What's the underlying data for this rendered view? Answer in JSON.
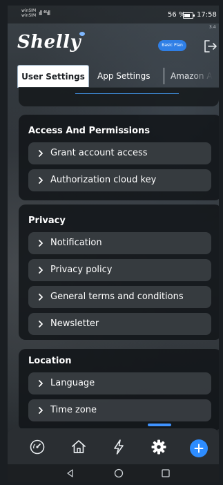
{
  "status_bar": {
    "sim1": "winSIM",
    "sim2": "winSIM",
    "signal": "ıll ⁴⁶ıll",
    "battery_percent": "56 %",
    "time": "17:58"
  },
  "header": {
    "logo": "Shelly",
    "version": "3.4",
    "plan_badge": "Basic Plan",
    "logout_icon": "logout-icon"
  },
  "tabs": [
    {
      "label": "User Settings",
      "active": true
    },
    {
      "label": "App Settings",
      "active": false
    },
    {
      "label": "Amazon A",
      "active": false
    }
  ],
  "sections": {
    "access": {
      "title": "Access And Permissions",
      "items": [
        {
          "label": "Grant account access"
        },
        {
          "label": "Authorization cloud key"
        }
      ]
    },
    "privacy": {
      "title": "Privacy",
      "items": [
        {
          "label": "Notification"
        },
        {
          "label": "Privacy policy"
        },
        {
          "label": "General terms and conditions"
        },
        {
          "label": "Newsletter"
        }
      ]
    },
    "location": {
      "title": "Location",
      "items": [
        {
          "label": "Language"
        },
        {
          "label": "Time zone"
        }
      ]
    }
  },
  "bottom_nav": {
    "items": [
      "dashboard-icon",
      "home-icon",
      "scenes-bolt-icon",
      "settings-gear-icon",
      "add-icon"
    ],
    "active": "settings-gear-icon"
  },
  "colors": {
    "accent": "#2d8cff",
    "card_bg": "#121518",
    "row_bg": "#3a3e42",
    "nav_bg": "#2a2e32"
  }
}
